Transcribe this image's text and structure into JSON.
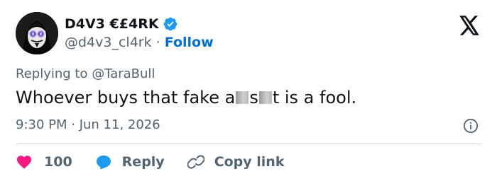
{
  "author": {
    "display_name": "D4V3 €£4RK",
    "handle": "@d4v3_cl4rk",
    "separator": "·",
    "follow_label": "Follow"
  },
  "tweet": {
    "replying_prefix": "Replying to",
    "replying_handle": "@TaraBull",
    "text_part1": "Whoever buys that fake a",
    "text_part2": " s",
    "text_part3": "t is a fool.",
    "timestamp": "9:30 PM · Jun 11, 2026"
  },
  "actions": {
    "like_count": "100",
    "reply_label": "Reply",
    "copy_label": "Copy link"
  },
  "colors": {
    "like": "#f91880",
    "reply": "#1d9bf0",
    "verified": "#1d9bf0",
    "follow": "#006fd6",
    "muted": "#536471",
    "text": "#0f1419"
  },
  "icons": {
    "verified": "verified-badge-icon",
    "platform": "x-logo-icon",
    "info": "info-icon",
    "like": "heart-icon",
    "reply": "speech-bubble-icon",
    "copy": "link-icon"
  }
}
